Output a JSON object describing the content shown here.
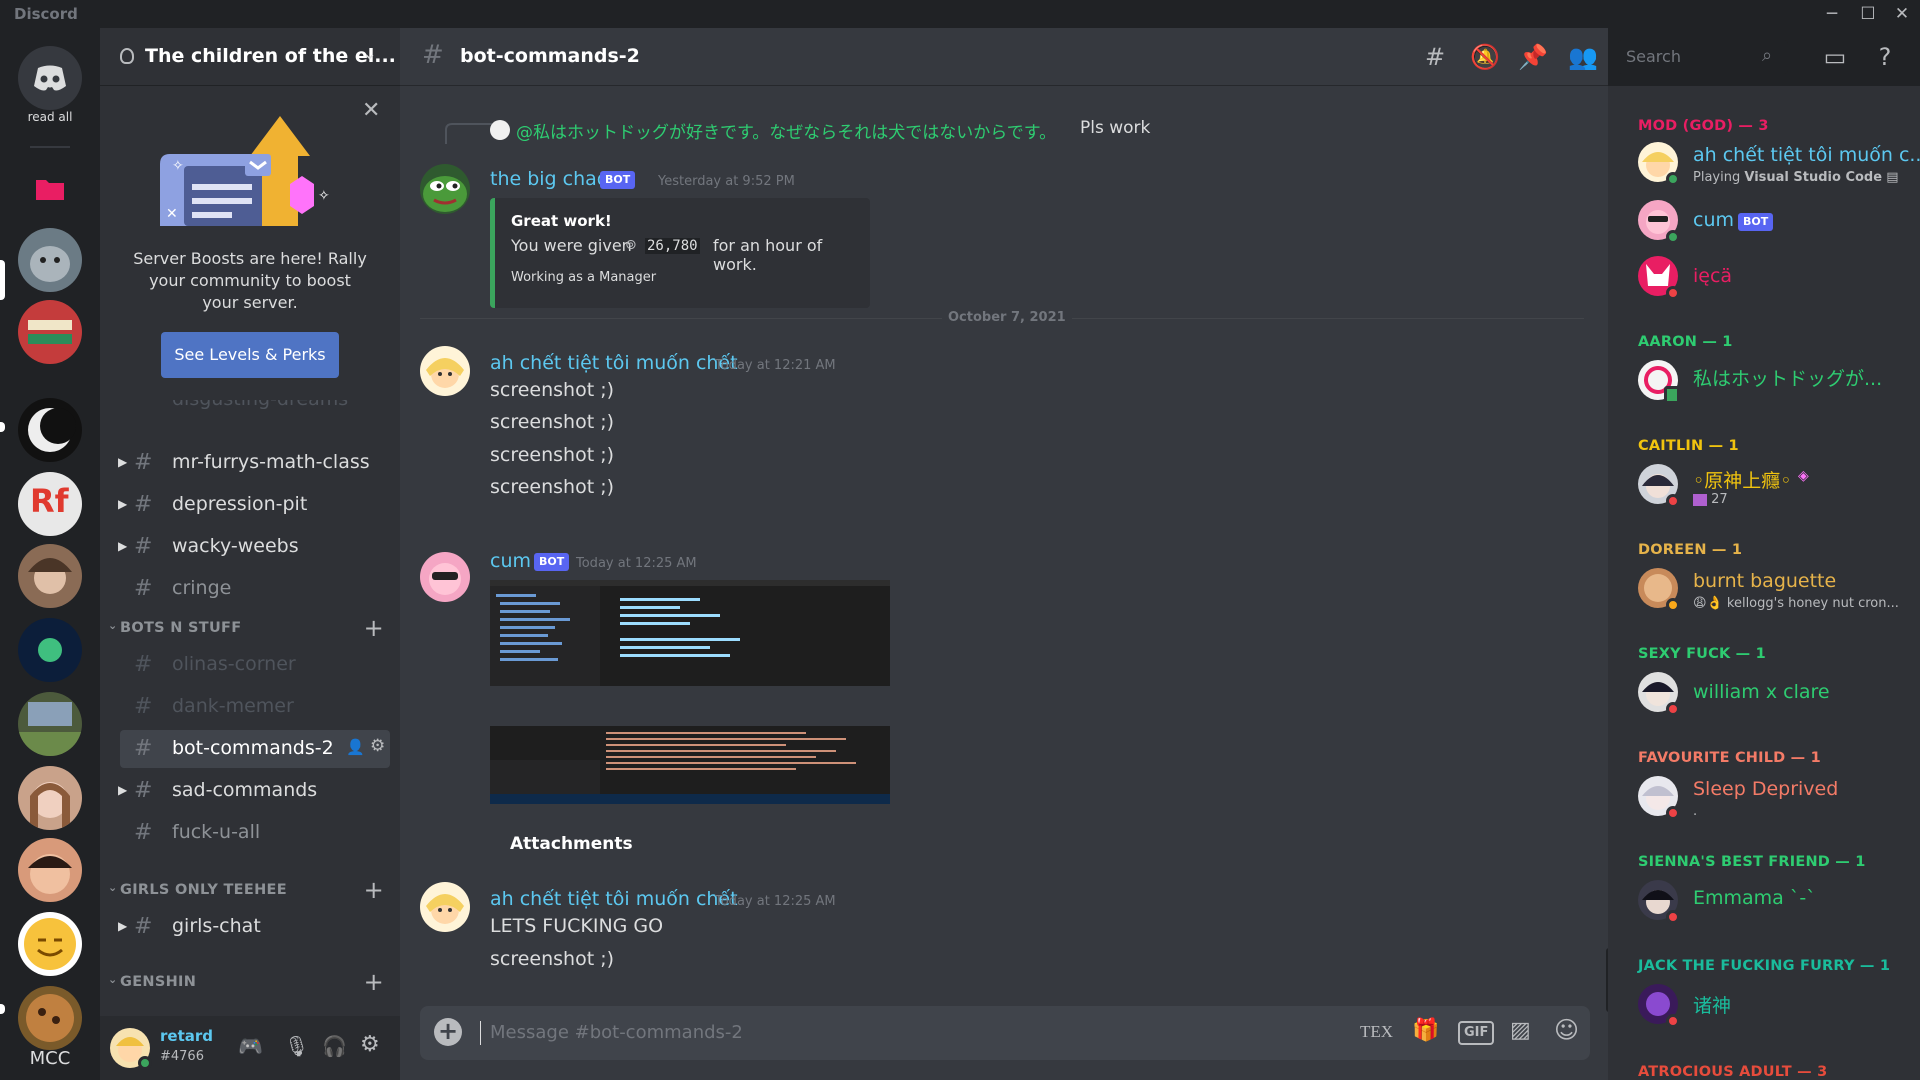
{
  "window": {
    "brand": "Discord",
    "minimize": "─",
    "maximize": "☐",
    "close": "✕"
  },
  "guilds": {
    "home_label": "read all",
    "footer": "MCC",
    "rf_label": "Rf"
  },
  "server": {
    "name": "The children of the el...",
    "boost_line": "Server Boosts are here! Rally your community to boost your server.",
    "boost_button": "See Levels & Perks"
  },
  "channels": {
    "partial_top": "disgusting-dreams",
    "list1": [
      "mr-furrys-math-class",
      "depression-pit",
      "wacky-weebs",
      "cringe"
    ],
    "cat_bots": "BOTS N STUFF",
    "bots": [
      "olinas-corner",
      "dank-memer",
      "bot-commands-2",
      "sad-commands",
      "fuck-u-all"
    ],
    "cat_girls": "GIRLS ONLY TEEHEE",
    "girls": [
      "girls-chat"
    ],
    "cat_genshin": "GENSHIN"
  },
  "user": {
    "name": "retard",
    "tag": "#4766"
  },
  "chat": {
    "channel": "bot-commands-2",
    "search_placeholder": "Search",
    "reply_ref": "@私はホットドッグが好きです。なぜならそれは犬ではないからです。",
    "reply_text": "Pls work",
    "m1_author": "the big chad",
    "bot_label": "BOT",
    "m1_time": "Yesterday at 9:52 PM",
    "embed_title": "Great work!",
    "embed_line_a": "You were given",
    "embed_amount": "26,780",
    "embed_line_b": "for an hour of work.",
    "embed_footer": "Working as a Manager",
    "date_divider": "October 7, 2021",
    "m2_author": "ah chết tiệt tôi muốn chết",
    "m2_time": "Today at 12:21 AM",
    "m2_lines": [
      "screenshot ;)",
      "screenshot ;)",
      "screenshot ;)",
      "screenshot ;)"
    ],
    "m3_author": "cum",
    "m3_time": "Today at 12:25 AM",
    "m3_caption": "Attachments",
    "m4_author": "ah chết tiệt tôi muốn chết",
    "m4_time": "Today at 12:25 AM",
    "m4_lines": [
      "LETS FUCKING GO",
      "screenshot ;)"
    ],
    "composer_placeholder": "Message #bot-commands-2",
    "tex_label": "TEX",
    "gif_label": "GIF"
  },
  "members": {
    "roles": [
      {
        "name": "MOD (GOD) — 3",
        "color": "#e91e63"
      },
      {
        "name": "AARON — 1",
        "color": "#2ecc71"
      },
      {
        "name": "CAITLIN — 1",
        "color": "#f1c40f"
      },
      {
        "name": "DOREEN — 1",
        "color": "#e6b34a"
      },
      {
        "name": "SEXY FUCK — 1",
        "color": "#2ecc71"
      },
      {
        "name": "FAVOURITE CHILD — 1",
        "color": "#f47b67"
      },
      {
        "name": "SIENNA'S BEST FRIEND — 1",
        "color": "#2ecc71"
      },
      {
        "name": "JACK THE FUCKING FURRY — 1",
        "color": "#1abc9c"
      },
      {
        "name": "ATROCIOUS ADULT — 3",
        "color": "#e74c3c"
      }
    ],
    "list": [
      {
        "name": "ah chết tiệt tôi muốn c...",
        "status_prefix": "Playing ",
        "status_app": "Visual Studio Code",
        "color": "#5cc8f0"
      },
      {
        "name": "cum",
        "color": "#5cc8f0"
      },
      {
        "name": "ięcä",
        "color": "#e91e63"
      },
      {
        "name": "私はホットドッグが...",
        "color": "#2ecc71"
      },
      {
        "name": "◦原神上癮◦",
        "status": "27",
        "color": "#f1c40f"
      },
      {
        "name": "burnt baguette",
        "status": "kellogg's honey nut cron...",
        "color": "#e6b34a"
      },
      {
        "name": "william x clare",
        "color": "#2ecc71"
      },
      {
        "name": "Sleep Deprived",
        "status": ".",
        "color": "#f47b67"
      },
      {
        "name": "Emmama `-`",
        "color": "#2ecc71"
      },
      {
        "name": "诸神",
        "color": "#1abc9c"
      }
    ]
  },
  "colors": {
    "accent": "#5865f2",
    "online": "#3ba55d",
    "dnd": "#ed4245",
    "idle": "#faa81a"
  }
}
